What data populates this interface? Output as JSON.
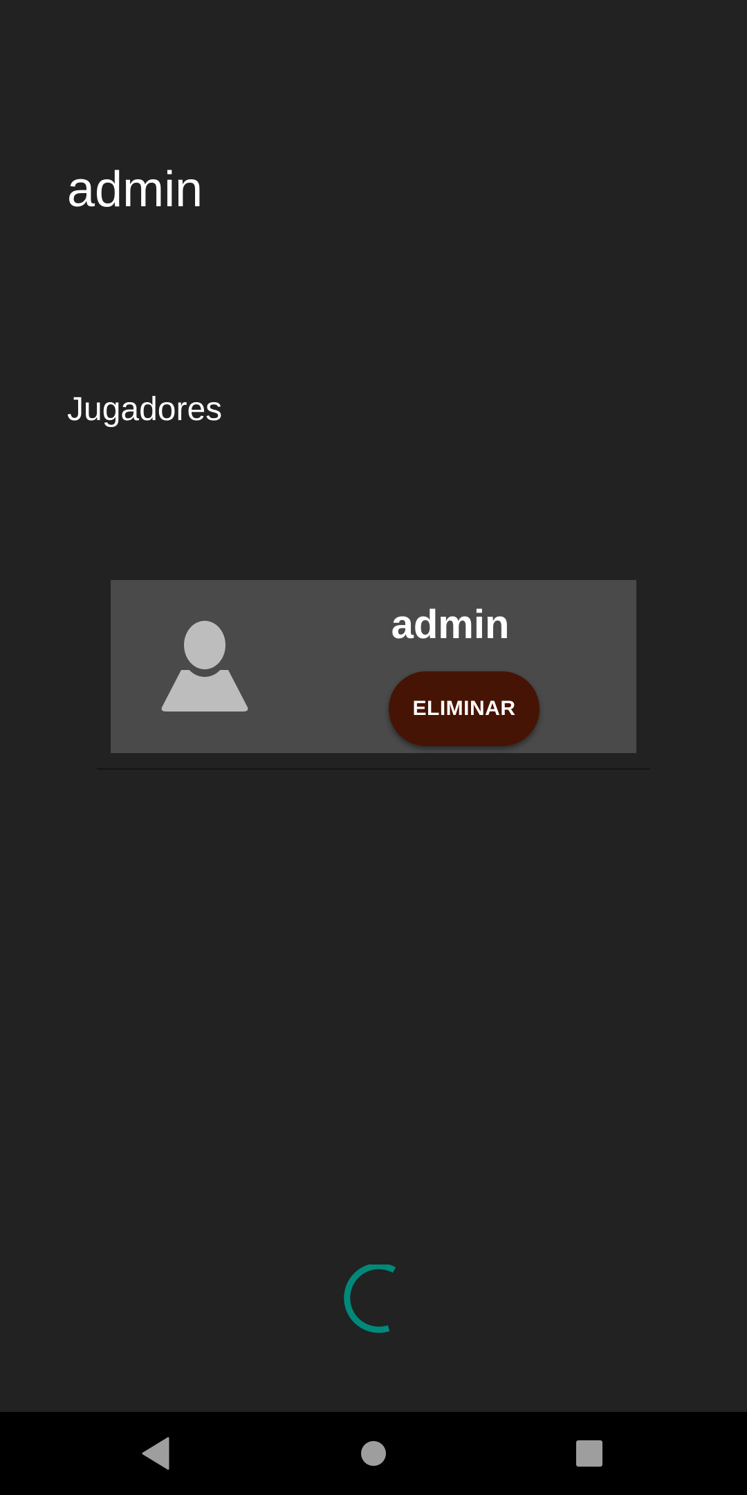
{
  "header": {
    "title": "admin"
  },
  "players_section": {
    "title": "Jugadores",
    "players": [
      {
        "name": "admin",
        "avatar_icon": "person-placeholder-icon",
        "delete_label": "ELIMINAR"
      }
    ]
  },
  "loading": {
    "icon": "progress-spinner-icon",
    "color": "#00897b"
  },
  "colors": {
    "background": "#222222",
    "card": "#4a4a4a",
    "delete_button": "#461404",
    "nav_bar": "#000000",
    "nav_icons": "#9e9e9e"
  },
  "nav_bar": {
    "back_icon": "back-triangle-icon",
    "home_icon": "home-circle-icon",
    "recents_icon": "recents-square-icon"
  }
}
